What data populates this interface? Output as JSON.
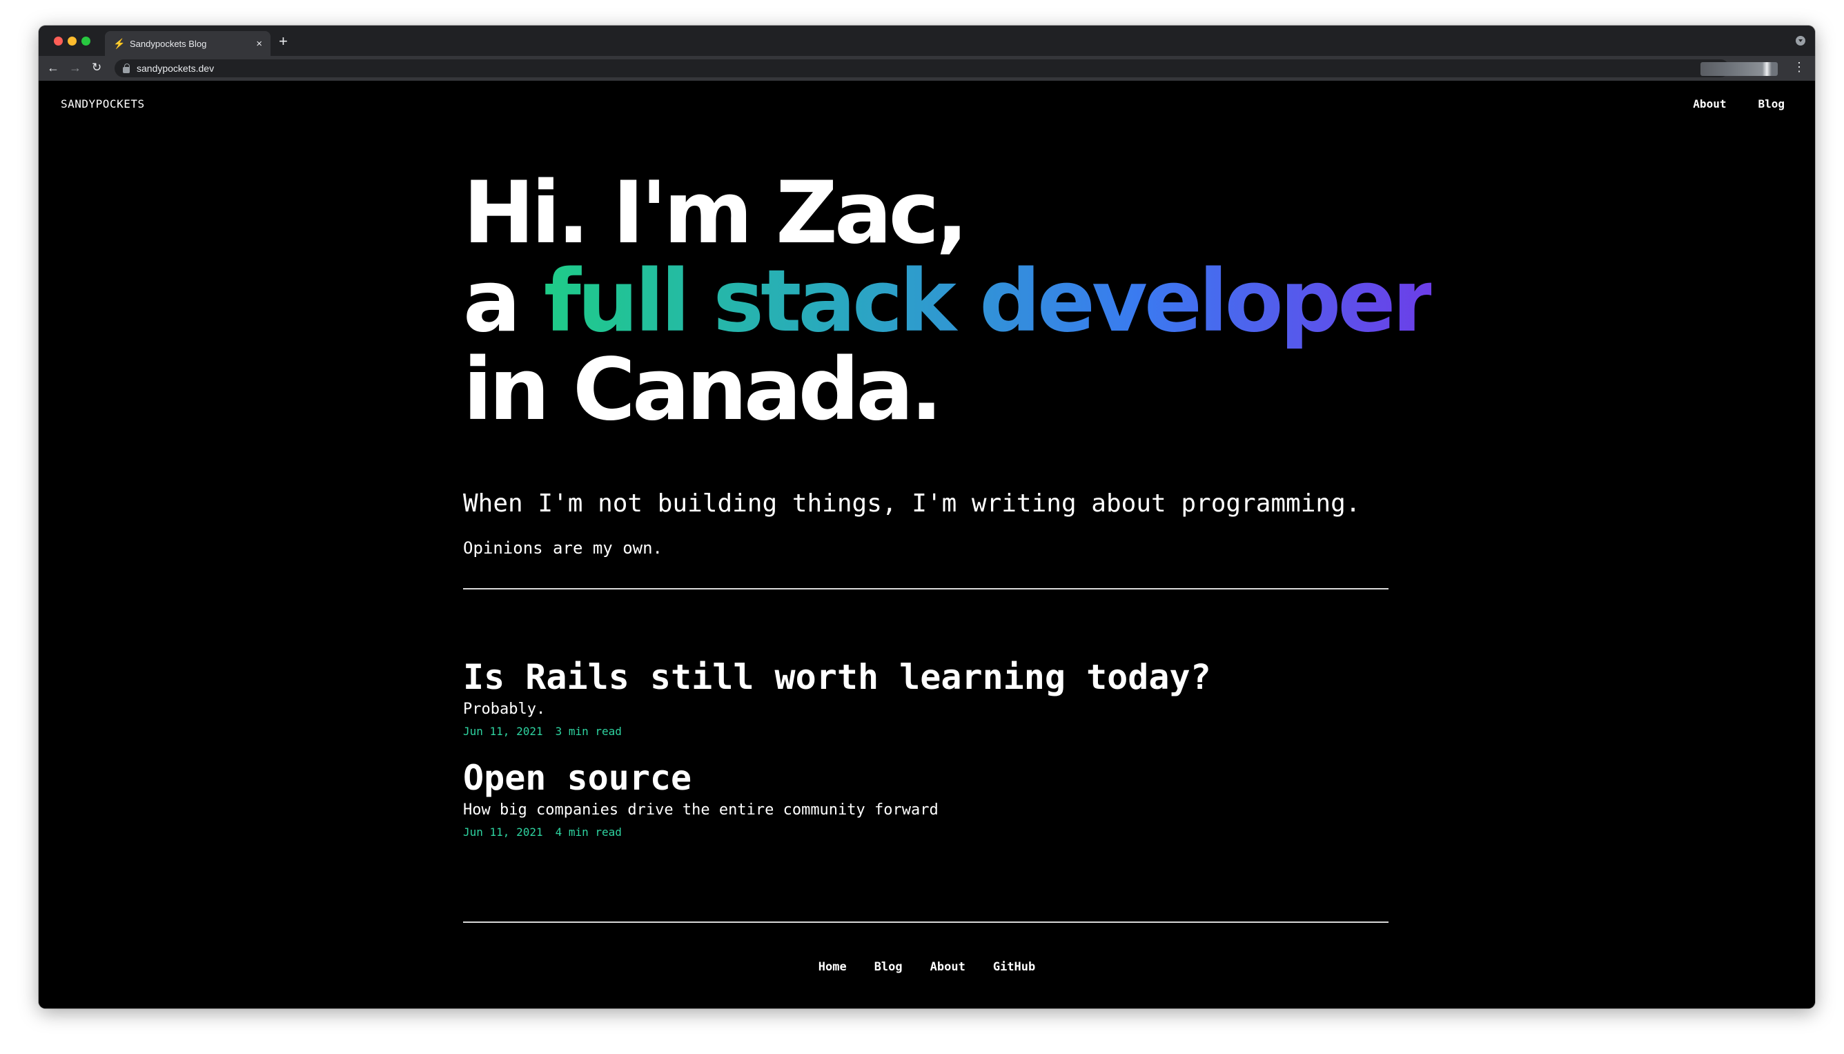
{
  "browser": {
    "tab_title": "Sandypockets Blog",
    "tab_favicon": "⚡",
    "tab_close": "×",
    "new_tab": "+",
    "url": "sandypockets.dev",
    "icons": [
      "back-arrow-icon",
      "forward-arrow-icon",
      "reload-icon",
      "lock-icon",
      "star-icon",
      "menu-dots-icon"
    ]
  },
  "header": {
    "logo": "SANDYPOCKETS",
    "nav": [
      "About",
      "Blog"
    ]
  },
  "hero": {
    "line1": "Hi. I'm Zac,",
    "line2_prefix": "a ",
    "line2_words": [
      "full",
      "stack",
      "developer"
    ],
    "line3": "in Canada.",
    "tagline": "When I'm not building things, I'm writing about programming.",
    "note": "Opinions are my own.",
    "gradient_colors": [
      "#1fcc88",
      "#2aa8c0",
      "#3a7bf0",
      "#6c3ee8"
    ]
  },
  "posts": [
    {
      "title": "Is Rails still worth learning today?",
      "subtitle": "Probably.",
      "date": "Jun 11, 2021",
      "read_time": "3 min read"
    },
    {
      "title": "Open source",
      "subtitle": "How big companies drive the entire community forward",
      "date": "Jun 11, 2021",
      "read_time": "4 min read"
    }
  ],
  "footer": {
    "links": [
      "Home",
      "Blog",
      "About",
      "GitHub"
    ]
  },
  "colors": {
    "background": "#000000",
    "text": "#ffffff",
    "meta_accent": "#2ed3a0"
  }
}
